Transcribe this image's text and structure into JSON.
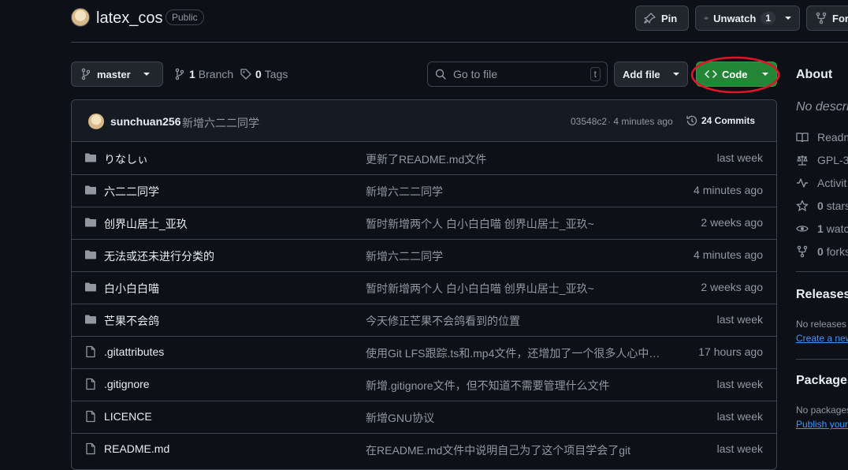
{
  "repo": {
    "name": "latex_cos",
    "visibility": "Public"
  },
  "header_actions": {
    "pin_label": "Pin",
    "unwatch_label": "Unwatch",
    "unwatch_count": "1",
    "fork_label": "Fork"
  },
  "toolbar": {
    "branch_selected": "master",
    "branch_count": "1",
    "branch_word": "Branch",
    "tag_count": "0",
    "tag_word": "Tags",
    "search_placeholder": "Go to file",
    "search_shortcut": "t",
    "add_file_label": "Add file",
    "code_label": "Code",
    "code_button_color": "#238636"
  },
  "latest_commit": {
    "author": "sunchuan256",
    "message": "新增六二二同学",
    "hash": "03548c2",
    "age": "· 4 minutes ago",
    "commit_count": "24 Commits"
  },
  "files": [
    {
      "name": "りなしぃ",
      "type": "folder",
      "message": "更新了README.md文件",
      "date": "last week"
    },
    {
      "name": "六二二同学",
      "type": "folder",
      "message": "新增六二二同学",
      "date": "4 minutes ago"
    },
    {
      "name": "创界山居士_亚玖",
      "type": "folder",
      "message": "暂时新增两个人 白小白白喵 创界山居士_亚玖~",
      "date": "2 weeks ago"
    },
    {
      "name": "无法或还未进行分类的",
      "type": "folder",
      "message": "新增六二二同学",
      "date": "4 minutes ago"
    },
    {
      "name": "白小白白喵",
      "type": "folder",
      "message": "暂时新增两个人 白小白白喵 创界山居士_亚玖~",
      "date": "2 weeks ago"
    },
    {
      "name": "芒果不会鸽",
      "type": "folder",
      "message": "今天修正芒果不会鸽看到的位置",
      "date": "last week"
    },
    {
      "name": ".gitattributes",
      "type": "file",
      "message": "使用Git LFS跟踪.ts和.mp4文件，还增加了一个很多人心中的...",
      "date": "17 hours ago"
    },
    {
      "name": ".gitignore",
      "type": "file",
      "message": "新增.gitignore文件，但不知道不需要管理什么文件",
      "date": "last week"
    },
    {
      "name": "LICENCE",
      "type": "file",
      "message": "新增GNU协议",
      "date": "last week"
    },
    {
      "name": "README.md",
      "type": "file",
      "message": "在README.md文件中说明自己为了这个项目学会了git",
      "date": "last week"
    }
  ],
  "about": {
    "heading": "About",
    "description": "No descrip",
    "links": [
      {
        "icon": "book-icon",
        "label": "Readm"
      },
      {
        "icon": "law-icon",
        "label": "GPL-3."
      },
      {
        "icon": "pulse-icon",
        "label": "Activit"
      },
      {
        "icon": "star-icon",
        "count": "0",
        "label": "stars"
      },
      {
        "icon": "eye-icon",
        "count": "1",
        "label": "watc"
      },
      {
        "icon": "fork-icon",
        "count": "0",
        "label": "forks"
      }
    ]
  },
  "releases": {
    "heading": "Releases",
    "text": "No releases p",
    "link": "Create a new"
  },
  "packages": {
    "heading": "Packages",
    "text": "No packages",
    "link": "Publish your"
  }
}
